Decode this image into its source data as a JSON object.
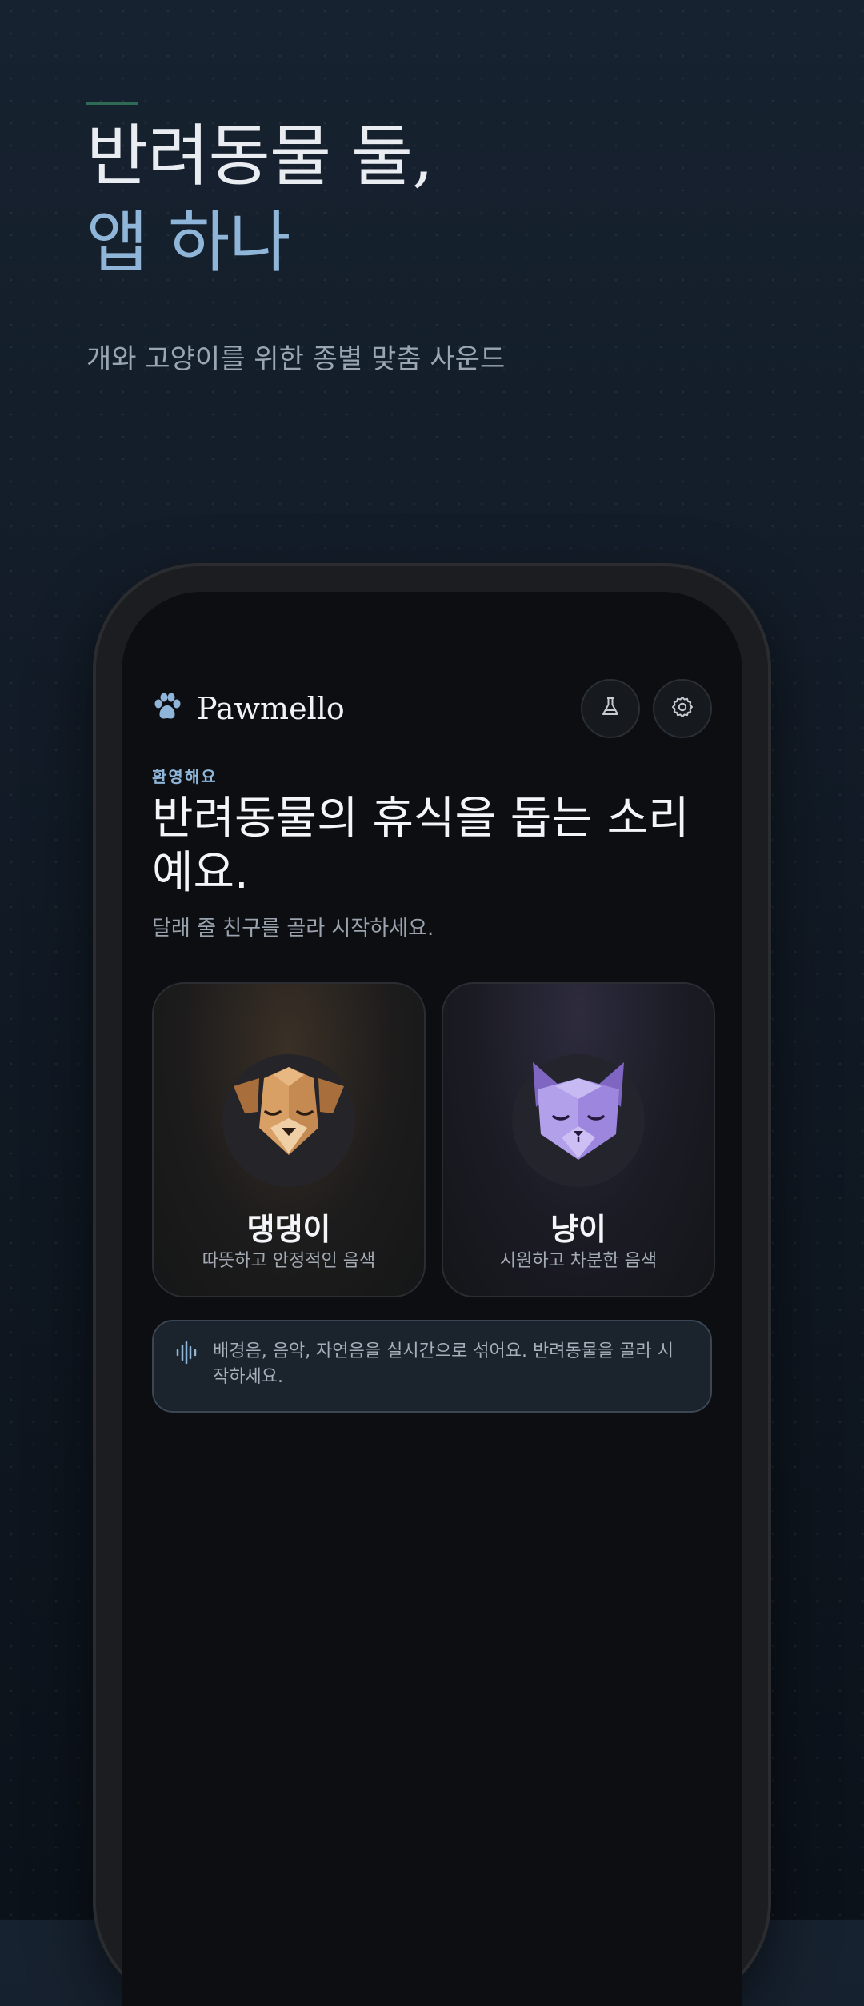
{
  "hero": {
    "title_line1": "반려동물 둘,",
    "title_line2": "앱 하나",
    "subtitle": "개와 고양이를 위한 종별 맞춤 사운드"
  },
  "app": {
    "brand_name": "Pawmello",
    "header_buttons": [
      "flask-icon",
      "gear-icon"
    ],
    "welcome_label": "환영해요",
    "welcome_title": "반려동물의 휴식을 돕는 소리예요.",
    "welcome_sub": "달래 줄 친구를 골라 시작하세요.",
    "cards": [
      {
        "title": "댕댕이",
        "subtitle": "따뜻하고 안정적인 음색",
        "icon": "dog-face-icon"
      },
      {
        "title": "냥이",
        "subtitle": "시원하고 차분한 음색",
        "icon": "cat-face-icon"
      }
    ],
    "info_text": "배경음, 음악, 자연음을 실시간으로 섞어요. 반려동물을 골라 시작하세요.",
    "info_icon": "waveform-icon"
  },
  "colors": {
    "accent": "#8fb5d8",
    "dog": "#d9a066",
    "cat": "#a892e0"
  }
}
